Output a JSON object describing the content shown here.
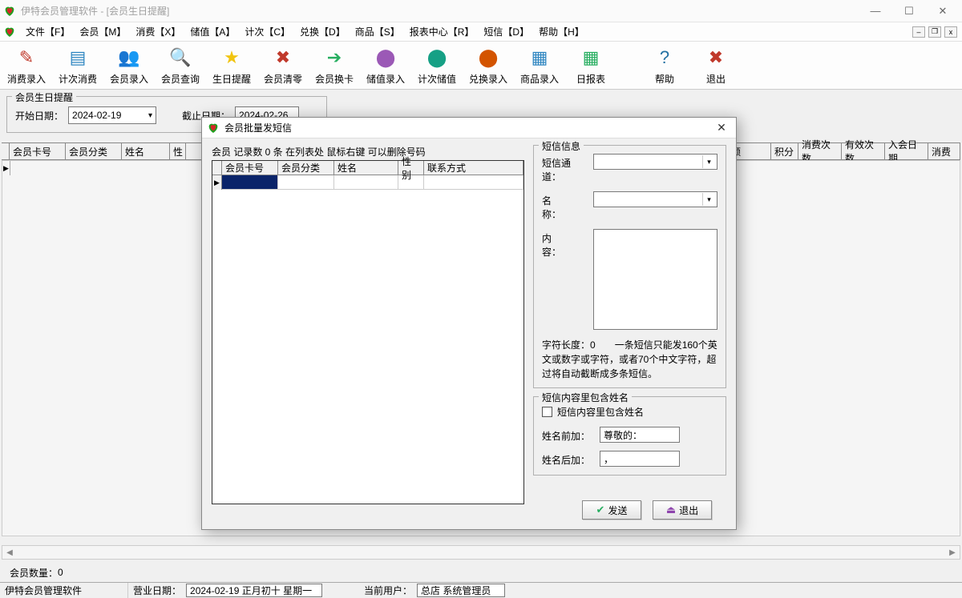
{
  "window": {
    "title": "伊特会员管理软件 - [会员生日提醒]"
  },
  "menu": {
    "items": [
      {
        "label": "文件【F】"
      },
      {
        "label": "会员【M】"
      },
      {
        "label": "消费【X】"
      },
      {
        "label": "储值【A】"
      },
      {
        "label": "计次【C】"
      },
      {
        "label": "兑换【D】"
      },
      {
        "label": "商品【S】"
      },
      {
        "label": "报表中心【R】"
      },
      {
        "label": "短信【D】"
      },
      {
        "label": "帮助【H】"
      }
    ]
  },
  "toolbar": {
    "items": [
      {
        "label": "消费录入",
        "icon": "✎",
        "color": "#c0392b"
      },
      {
        "label": "计次消费",
        "icon": "▤",
        "color": "#2e86c1"
      },
      {
        "label": "会员录入",
        "icon": "👥",
        "color": "#d4ac0d"
      },
      {
        "label": "会员查询",
        "icon": "🔍",
        "color": "#5d6d7e"
      },
      {
        "label": "生日提醒",
        "icon": "★",
        "color": "#f1c40f"
      },
      {
        "label": "会员清零",
        "icon": "✖",
        "color": "#c0392b"
      },
      {
        "label": "会员换卡",
        "icon": "➔",
        "color": "#27ae60"
      },
      {
        "label": "储值录入",
        "icon": "⬤",
        "color": "#9b59b6"
      },
      {
        "label": "计次储值",
        "icon": "⬤",
        "color": "#16a085"
      },
      {
        "label": "兑换录入",
        "icon": "⬤",
        "color": "#d35400"
      },
      {
        "label": "商品录入",
        "icon": "▦",
        "color": "#2e86c1"
      },
      {
        "label": "日报表",
        "icon": "▦",
        "color": "#27ae60"
      },
      {
        "label": "帮助",
        "icon": "?",
        "color": "#2471a3"
      },
      {
        "label": "退出",
        "icon": "✖",
        "color": "#c0392b"
      }
    ]
  },
  "filter": {
    "legend": "会员生日提醒",
    "start_label": "开始日期：",
    "start_value": "2024-02-19",
    "end_label": "截止日期：",
    "end_value": "2024-02-26"
  },
  "bg_grid": {
    "columns": [
      "会员卡号",
      "会员分类",
      "姓名",
      "性",
      "",
      "",
      "",
      "",
      "额",
      "积分",
      "消费次数",
      "有效次数",
      "入会日期",
      "消费"
    ]
  },
  "dialog": {
    "title": "会员批量发短信",
    "left_hint": "会员 记录数 0 条   在列表处 鼠标右键 可以删除号码",
    "table_cols": [
      "会员卡号",
      "会员分类",
      "姓名",
      "性别",
      "联系方式"
    ],
    "sms": {
      "legend": "短信信息",
      "channel_label": "短信通道：",
      "name_label": "名　　称：",
      "content_label": "内　　容：",
      "note_prefix": "字符长度：",
      "char_count": "0",
      "note_rest": "　　一条短信只能发160个英文或数字或字符，或者70个中文字符，超过将自动截断成多条短信。"
    },
    "nameopt": {
      "legend": "短信内容里包含姓名",
      "checkbox_label": "短信内容里包含姓名",
      "prefix_label": "姓名前加：",
      "prefix_value": "尊敬的：",
      "suffix_label": "姓名后加：",
      "suffix_value": "，"
    },
    "btn_send": "发送",
    "btn_exit": "退出"
  },
  "footer": {
    "member_count_label": "会员数量：",
    "member_count_value": "0",
    "app_name": "伊特会员管理软件",
    "biz_date_label": "营业日期：",
    "biz_date_value": "2024-02-19  正月初十  星期一",
    "user_label": "当前用户：",
    "user_value": "总店 系统管理员"
  }
}
